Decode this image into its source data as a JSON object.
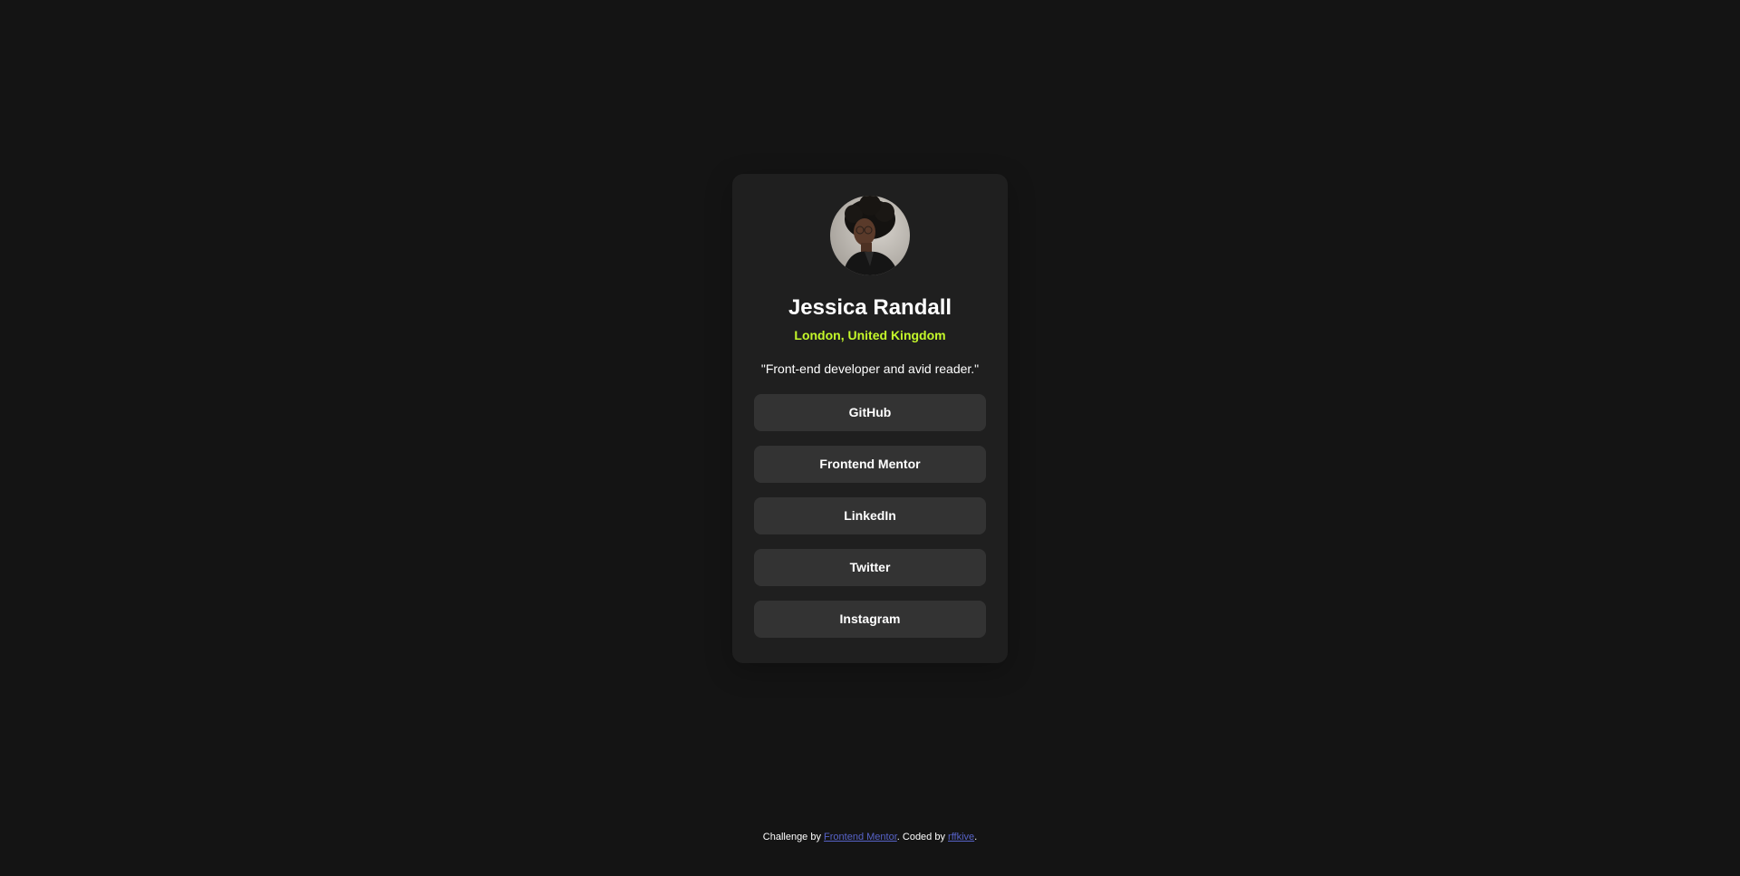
{
  "profile": {
    "name": "Jessica Randall",
    "location": "London, United Kingdom",
    "bio": "\"Front-end developer and avid reader.\""
  },
  "links": [
    {
      "label": "GitHub"
    },
    {
      "label": "Frontend Mentor"
    },
    {
      "label": "LinkedIn"
    },
    {
      "label": "Twitter"
    },
    {
      "label": "Instagram"
    }
  ],
  "attribution": {
    "prefix": "Challenge by ",
    "challenge_link": "Frontend Mentor",
    "middle": ". Coded by ",
    "coder_link": "rffkive",
    "suffix": "."
  },
  "colors": {
    "background": "#141414",
    "card": "#1f1f1f",
    "button": "#333333",
    "accent": "#c4f82a",
    "link": "#5763c9"
  }
}
